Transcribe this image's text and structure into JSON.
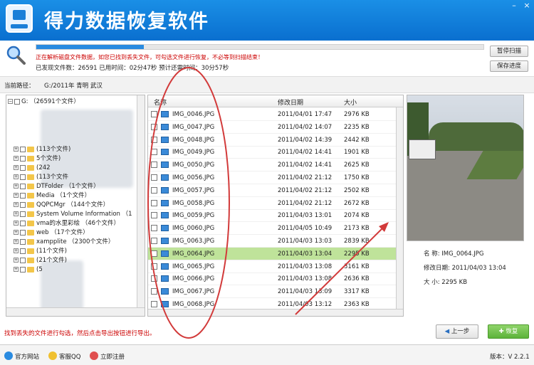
{
  "app": {
    "title": "得力数据恢复软件",
    "minimize": "–",
    "close": "×"
  },
  "status": {
    "progress": 0.24,
    "warning": "正在解析磁盘文件数据，如您已找到丢失文件，可勾选文件进行恢复，不必等到扫描结束！",
    "stats": "已发现文件数：26591  已用时间：02分47秒  预计还需时间：30分57秒"
  },
  "buttons": {
    "pause": "暂停扫描",
    "save": "保存进度",
    "back": "上一步",
    "recover": "恢复"
  },
  "path": {
    "label": "当前路径：",
    "value": "G:/2011年 青明  武汉"
  },
  "tree": {
    "root": "G: （26591个文件）",
    "items": [
      {
        "label": "(113个文件)"
      },
      {
        "label": "5个文件)"
      },
      {
        "label": "(242"
      },
      {
        "label": "(113个文件"
      },
      {
        "label": "DTFolder （1个文件）"
      },
      {
        "label": "Media （1个文件）"
      },
      {
        "label": "QQPCMgr （144个文件）"
      },
      {
        "label": "System Volume Information （1"
      },
      {
        "label": "vma的水里彩绘 （46个文件）"
      },
      {
        "label": "web （17个文件）"
      },
      {
        "label": "xampplite （2300个文件）"
      },
      {
        "label": "(11个文件)"
      },
      {
        "label": "(21个文件)"
      },
      {
        "label": "(5"
      }
    ]
  },
  "filelist": {
    "columns": [
      "名称",
      "修改日期",
      "大小"
    ],
    "rows": [
      {
        "name": "IMG_0046.JPG",
        "date": "2011/04/01 17:47",
        "size": "2976 KB"
      },
      {
        "name": "IMG_0047.JPG",
        "date": "2011/04/02 14:07",
        "size": "2235 KB"
      },
      {
        "name": "IMG_0048.JPG",
        "date": "2011/04/02 14:39",
        "size": "2442 KB"
      },
      {
        "name": "IMG_0049.JPG",
        "date": "2011/04/02 14:41",
        "size": "1901 KB"
      },
      {
        "name": "IMG_0050.JPG",
        "date": "2011/04/02 14:41",
        "size": "2625 KB"
      },
      {
        "name": "IMG_0056.JPG",
        "date": "2011/04/02 21:12",
        "size": "1750 KB"
      },
      {
        "name": "IMG_0057.JPG",
        "date": "2011/04/02 21:12",
        "size": "2502 KB"
      },
      {
        "name": "IMG_0058.JPG",
        "date": "2011/04/02 21:12",
        "size": "2672 KB"
      },
      {
        "name": "IMG_0059.JPG",
        "date": "2011/04/03 13:01",
        "size": "2074 KB"
      },
      {
        "name": "IMG_0060.JPG",
        "date": "2011/04/05 10:49",
        "size": "2173 KB"
      },
      {
        "name": "IMG_0063.JPG",
        "date": "2011/04/03 13:03",
        "size": "2839 KB"
      },
      {
        "name": "IMG_0064.JPG",
        "date": "2011/04/03 13:04",
        "size": "2295 KB",
        "selected": true
      },
      {
        "name": "IMG_0065.JPG",
        "date": "2011/04/03 13:08",
        "size": "3161 KB"
      },
      {
        "name": "IMG_0066.JPG",
        "date": "2011/04/03 13:08",
        "size": "2636 KB"
      },
      {
        "name": "IMG_0067.JPG",
        "date": "2011/04/03 13:09",
        "size": "3317 KB"
      },
      {
        "name": "IMG_0068.JPG",
        "date": "2011/04/03 13:12",
        "size": "2363 KB"
      }
    ]
  },
  "preview": {
    "name_label": "名    称:",
    "name": "IMG_0064.JPG",
    "date_label": "修改日期:",
    "date": "2011/04/03 13:04",
    "size_label": "大    小:",
    "size": "2295 KB"
  },
  "hint": "找到丢失的文件进行勾选，然后点击导出按钮进行导出。",
  "footer": {
    "site": "官方网站",
    "qq": "客服QQ",
    "register": "立即注册",
    "version": "版本：V 2.2.1"
  },
  "colors": {
    "annotation": "#d23a3a",
    "titlebar": "#0a6fcf",
    "selected_row": "#bfe39a"
  }
}
